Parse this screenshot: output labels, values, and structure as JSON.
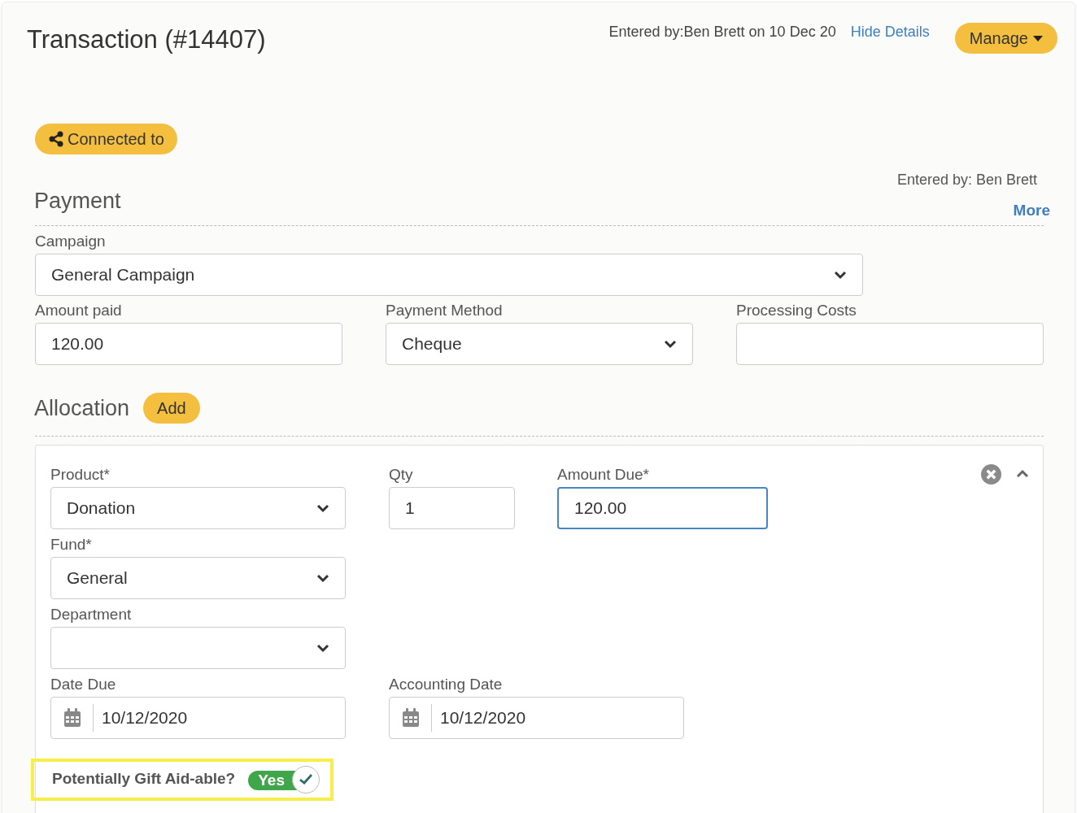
{
  "header": {
    "title": "Transaction (#14407)",
    "entered": "Entered by:Ben Brett on 10 Dec 20",
    "hide_details": "Hide Details",
    "manage": "Manage"
  },
  "connected_button": "Connected to",
  "payment": {
    "entered_by": "Entered by: Ben Brett",
    "heading": "Payment",
    "more": "More",
    "campaign": {
      "label": "Campaign",
      "value": "General Campaign"
    },
    "fields": [
      {
        "kind": "input",
        "label": "Amount paid",
        "value": "120.00"
      },
      {
        "kind": "select",
        "label": "Payment Method",
        "value": "Cheque"
      },
      {
        "kind": "input",
        "label": "Processing Costs"
      }
    ]
  },
  "allocation": {
    "heading": "Allocation",
    "add": "Add",
    "expanded": true,
    "product": {
      "label": "Product*",
      "value": "Donation"
    },
    "qty": {
      "label": "Qty",
      "value": "1",
      "focused": false
    },
    "amount_due": {
      "label": "Amount Due*",
      "value": "120.00",
      "focused": true
    },
    "fund": {
      "label": "Fund*",
      "value": "General"
    },
    "department": {
      "label": "Department"
    },
    "date_due": {
      "label": "Date Due",
      "value": "10/12/2020"
    },
    "accounting_date": {
      "label": "Accounting Date",
      "value": "10/12/2020"
    },
    "gift_aid": {
      "label": "Potentially Gift Aid-able?",
      "on": true,
      "value_label": "Yes",
      "highlighted": true
    }
  }
}
